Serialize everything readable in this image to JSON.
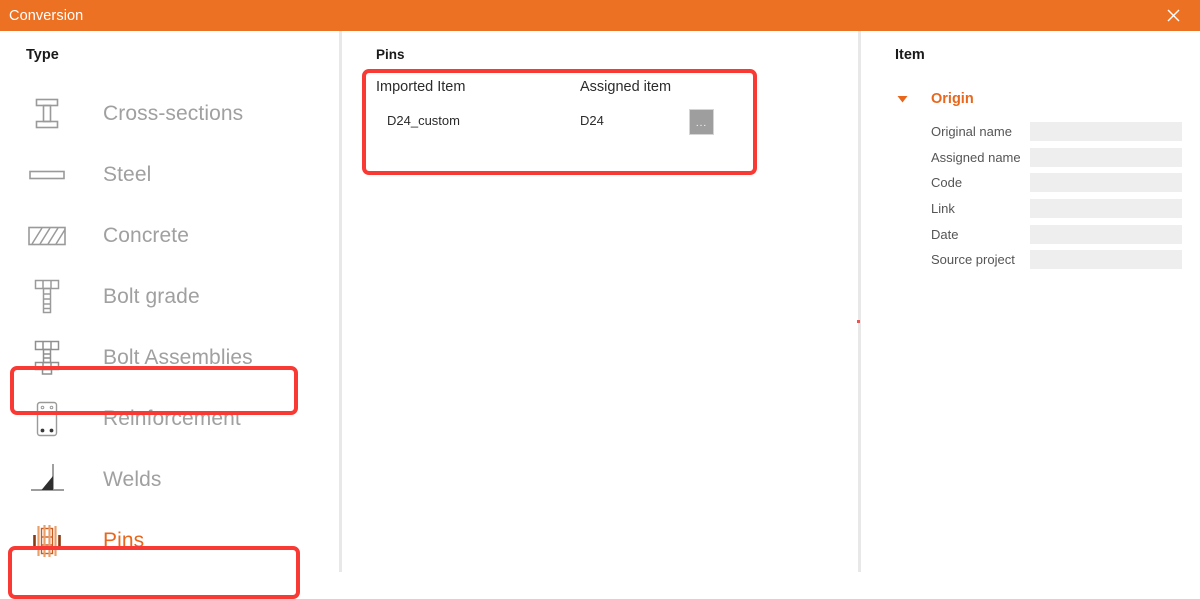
{
  "window": {
    "title": "Conversion",
    "accent_color": "#ED7123",
    "close_icon": "close-icon",
    "highlight_color": "#F93A34"
  },
  "type_panel": {
    "heading": "Type",
    "items": [
      {
        "label": "Cross-sections",
        "icon": "i-beam-icon",
        "selected": false,
        "highlighted": false
      },
      {
        "label": "Steel",
        "icon": "plate-icon",
        "selected": false,
        "highlighted": false
      },
      {
        "label": "Concrete",
        "icon": "concrete-hatch-icon",
        "selected": false,
        "highlighted": false
      },
      {
        "label": "Bolt grade",
        "icon": "bolt-icon",
        "selected": false,
        "highlighted": false
      },
      {
        "label": "Bolt Assemblies",
        "icon": "bolt-assembly-icon",
        "selected": false,
        "highlighted": true
      },
      {
        "label": "Reinforcement",
        "icon": "rebar-section-icon",
        "selected": false,
        "highlighted": false
      },
      {
        "label": "Welds",
        "icon": "weld-icon",
        "selected": false,
        "highlighted": false
      },
      {
        "label": "Pins",
        "icon": "pin-icon",
        "selected": true,
        "highlighted": true
      }
    ]
  },
  "table_panel": {
    "title": "Pins",
    "highlighted": true,
    "columns": [
      "Imported Item",
      "Assigned item"
    ],
    "rows": [
      {
        "imported_item": "D24_custom",
        "assigned_item": "D24",
        "browse_label": "..."
      }
    ]
  },
  "item_panel": {
    "title": "Item",
    "group": {
      "name": "Origin",
      "expanded": true,
      "caret_icon": "caret-down-icon"
    },
    "properties": [
      {
        "label": "Original name",
        "value": ""
      },
      {
        "label": "Assigned name",
        "value": ""
      },
      {
        "label": "Code",
        "value": ""
      },
      {
        "label": "Link",
        "value": ""
      },
      {
        "label": "Date",
        "value": ""
      },
      {
        "label": "Source project",
        "value": ""
      }
    ]
  }
}
